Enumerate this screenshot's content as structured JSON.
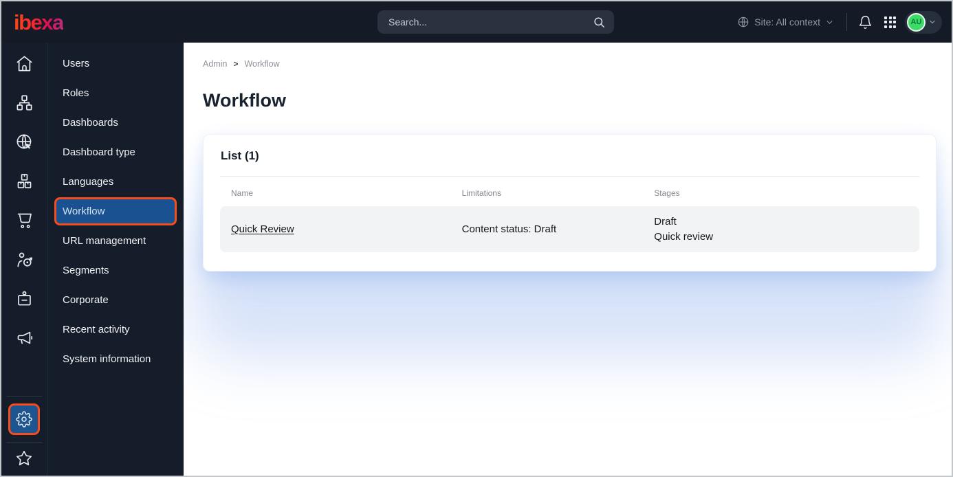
{
  "colors": {
    "annotation_orange": "#f74c1c",
    "selected_blue": "#1a5190",
    "topbar_bg": "#141b27",
    "avatar_green": "#3edb69",
    "sidebar_bg": "#161d2a"
  },
  "topbar": {
    "logo_text": "ibexa",
    "search_placeholder": "Search...",
    "site_label": "Site: All context",
    "avatar_initials": "AU"
  },
  "icon_rail": {
    "icons": [
      "home",
      "content-tree",
      "site-globe",
      "product-boxes",
      "commerce-cart",
      "person-target",
      "id-badge",
      "megaphone"
    ],
    "bottom_icons": [
      "settings-gear",
      "star"
    ],
    "active": "settings-gear"
  },
  "menu": {
    "items": [
      "Users",
      "Roles",
      "Dashboards",
      "Dashboard type",
      "Languages",
      "Workflow",
      "URL management",
      "Segments",
      "Corporate",
      "Recent activity",
      "System information"
    ],
    "selected": "Workflow"
  },
  "breadcrumb": {
    "items": [
      "Admin",
      "Workflow"
    ],
    "separator": ">"
  },
  "page": {
    "title": "Workflow"
  },
  "list_card": {
    "title": "List (1)",
    "columns": [
      "Name",
      "Limitations",
      "Stages"
    ],
    "rows": [
      {
        "name": "Quick Review",
        "limitations": "Content status: Draft",
        "stages": [
          "Draft",
          "Quick review"
        ]
      }
    ]
  }
}
